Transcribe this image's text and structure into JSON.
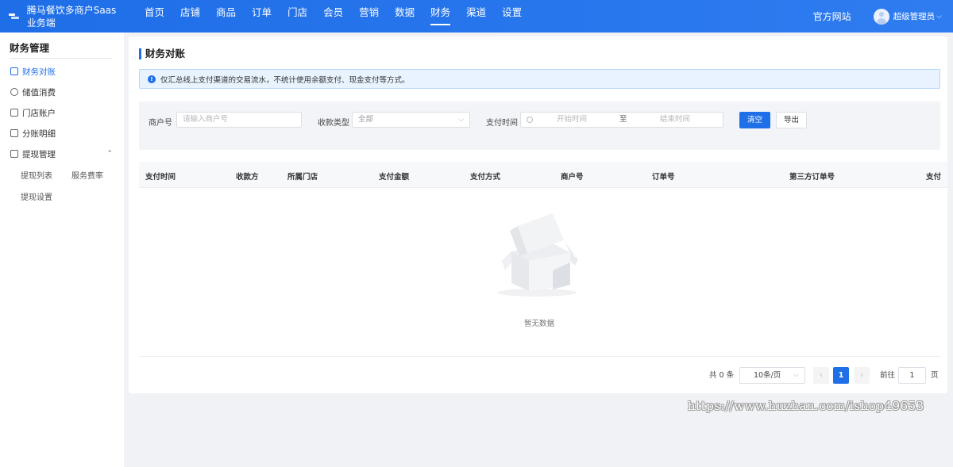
{
  "brand": {
    "name": "腾马餐饮多商户Saas业务端"
  },
  "nav": {
    "items": [
      "首页",
      "店铺",
      "商品",
      "订单",
      "门店",
      "会员",
      "营销",
      "数据",
      "财务",
      "渠道",
      "设置"
    ],
    "active": "财务",
    "official_site": "官方网站",
    "user_name": "超级管理员",
    "user_caret": "⌵"
  },
  "sidebar": {
    "title": "财务管理",
    "items": [
      {
        "label": "财务对账",
        "icon": "document-icon",
        "active": true
      },
      {
        "label": "储值消费",
        "icon": "coin-icon"
      },
      {
        "label": "门店账户",
        "icon": "card-icon"
      },
      {
        "label": "分账明细",
        "icon": "document-icon"
      },
      {
        "label": "提现管理",
        "icon": "document-icon",
        "expanded": true,
        "caret": "⌃"
      }
    ],
    "sub_items": [
      "提现列表",
      "服务费率",
      "提现设置"
    ]
  },
  "page": {
    "title": "财务对账",
    "alert": "仅汇总线上支付渠道的交易流水，不统计使用余额支付、现金支付等方式。",
    "alert_icon": "!"
  },
  "filter": {
    "merchant_label": "商户号",
    "merchant_placeholder": "请输入商户号",
    "type_label": "收款类型",
    "type_value": "全部",
    "time_label": "支付时间",
    "time_start_placeholder": "开始时间",
    "time_separator": "至",
    "time_end_placeholder": "结束时间",
    "clear_button": "清空",
    "export_button": "导出"
  },
  "table": {
    "columns": [
      "支付时间",
      "收款方",
      "所属门店",
      "支付金额",
      "支付方式",
      "商户号",
      "订单号",
      "第三方订单号",
      "支付"
    ],
    "rows": [],
    "empty_text": "暂无数据"
  },
  "pagination": {
    "total": "共 0 条",
    "page_size": "10条/页",
    "current_page": "1",
    "prev": "‹",
    "next": "›",
    "goto_label": "前往",
    "goto_value": "1",
    "goto_suffix": "页"
  },
  "watermark": "https://www.huzhan.com/ishop49653",
  "colors": {
    "primary": "#1f6fe8",
    "header": "#1e6ee8",
    "background": "#f0f2f5",
    "alert_bg": "#e8f3ff"
  }
}
